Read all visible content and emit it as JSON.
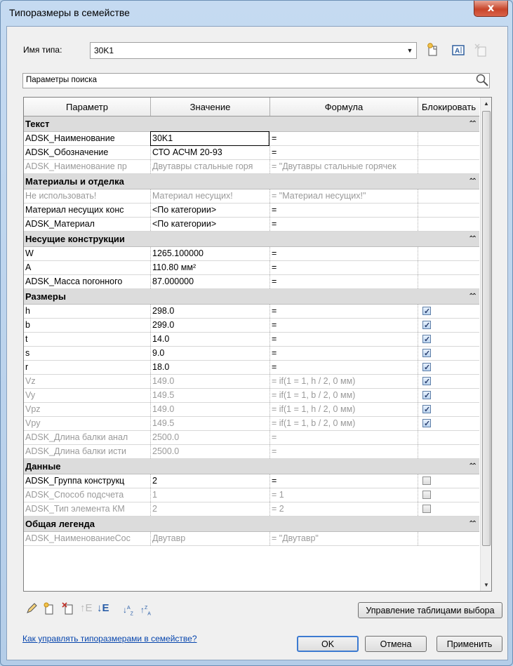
{
  "window": {
    "title": "Типоразмеры в семействе",
    "close_glyph": "x"
  },
  "type_name": {
    "label": "Имя типа:",
    "value": "30K1"
  },
  "search": {
    "placeholder": "Параметры поиска"
  },
  "table": {
    "headers": [
      "Параметр",
      "Значение",
      "Формула",
      "Блокировать"
    ],
    "groups": [
      {
        "title": "Текст",
        "rows": [
          {
            "p": "ADSK_Наименование",
            "v": "30K1",
            "f": "=",
            "lock": null,
            "gray": false,
            "edit": true
          },
          {
            "p": "ADSK_Обозначение",
            "v": "СТО АСЧМ 20-93",
            "f": "=",
            "lock": null,
            "gray": false
          },
          {
            "p": "ADSK_Наименование пр",
            "v": "Двутавры стальные горя",
            "f": "= \"Двутавры стальные горячек",
            "lock": null,
            "gray": true
          }
        ]
      },
      {
        "title": "Материалы и отделка",
        "rows": [
          {
            "p": "Не использовать!",
            "v": "Материал несущих!",
            "f": "= \"Материал несущих!\"",
            "lock": null,
            "gray": true
          },
          {
            "p": "Материал несущих конс",
            "v": "<По категории>",
            "f": "=",
            "lock": null,
            "gray": false
          },
          {
            "p": "ADSK_Материал",
            "v": "<По категории>",
            "f": "=",
            "lock": null,
            "gray": false
          }
        ]
      },
      {
        "title": "Несущие конструкции",
        "rows": [
          {
            "p": "W",
            "v": "1265.100000",
            "f": "=",
            "lock": null,
            "gray": false
          },
          {
            "p": "A",
            "v": "110.80 мм²",
            "f": "=",
            "lock": null,
            "gray": false
          },
          {
            "p": "ADSK_Масса погонного",
            "v": "87.000000",
            "f": "=",
            "lock": null,
            "gray": false
          }
        ]
      },
      {
        "title": "Размеры",
        "rows": [
          {
            "p": "h",
            "v": "298.0",
            "f": "=",
            "lock": true,
            "gray": false
          },
          {
            "p": "b",
            "v": "299.0",
            "f": "=",
            "lock": true,
            "gray": false
          },
          {
            "p": "t",
            "v": "14.0",
            "f": "=",
            "lock": true,
            "gray": false
          },
          {
            "p": "s",
            "v": "9.0",
            "f": "=",
            "lock": true,
            "gray": false
          },
          {
            "p": "r",
            "v": "18.0",
            "f": "=",
            "lock": true,
            "gray": false
          },
          {
            "p": "Vz",
            "v": "149.0",
            "f": "= if(1 = 1, h / 2, 0 мм)",
            "lock": true,
            "gray": true
          },
          {
            "p": "Vy",
            "v": "149.5",
            "f": "= if(1 = 1, b / 2, 0 мм)",
            "lock": true,
            "gray": true
          },
          {
            "p": "Vpz",
            "v": "149.0",
            "f": "= if(1 = 1, h / 2, 0 мм)",
            "lock": true,
            "gray": true
          },
          {
            "p": "Vpy",
            "v": "149.5",
            "f": "= if(1 = 1, b / 2, 0 мм)",
            "lock": true,
            "gray": true
          },
          {
            "p": "ADSK_Длина балки анал",
            "v": "2500.0",
            "f": "=",
            "lock": null,
            "gray": true
          },
          {
            "p": "ADSK_Длина балки исти",
            "v": "2500.0",
            "f": "=",
            "lock": null,
            "gray": true
          }
        ]
      },
      {
        "title": "Данные",
        "rows": [
          {
            "p": "ADSK_Группа конструкц",
            "v": "2",
            "f": "=",
            "lock": false,
            "gray": false
          },
          {
            "p": "ADSK_Способ подсчета",
            "v": "1",
            "f": "= 1",
            "lock": false,
            "gray": true
          },
          {
            "p": "ADSK_Тип элемента КМ",
            "v": "2",
            "f": "= 2",
            "lock": false,
            "gray": true
          }
        ]
      },
      {
        "title": "Общая легенда",
        "rows": [
          {
            "p": "ADSK_НаименованиеСос",
            "v": "Двутавр",
            "f": "= \"Двутавр\"",
            "lock": null,
            "gray": true
          }
        ]
      }
    ]
  },
  "toolbar_icons": [
    "pencil-icon",
    "new-type-icon",
    "duplicate-type-icon",
    "rename-type-icon",
    "delete-type-icon",
    "sort-ascending-icon",
    "sort-descending-icon"
  ],
  "lookup_button": "Управление таблицами выбора",
  "help_link": "Как управлять типоразмерами в семействе?",
  "buttons": {
    "ok": "OK",
    "cancel": "Отмена",
    "apply": "Применить"
  }
}
